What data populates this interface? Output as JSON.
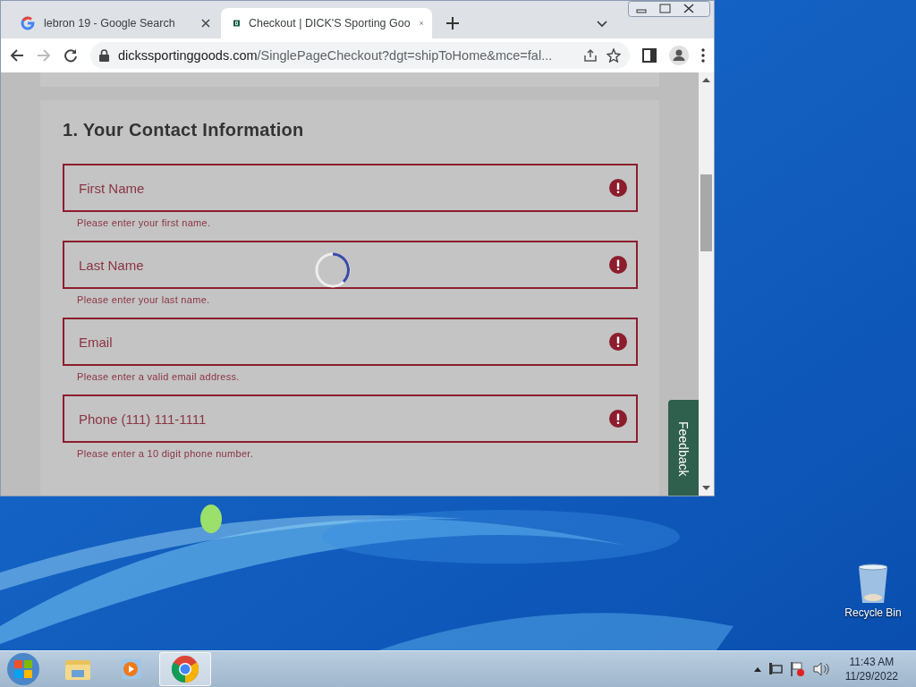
{
  "browser": {
    "tabs": [
      {
        "title": "lebron 19 - Google Search",
        "kind": "google",
        "selected": false
      },
      {
        "title": "Checkout | DICK'S Sporting Goo",
        "kind": "dicks",
        "selected": true
      }
    ],
    "address": {
      "domain": "dickssportinggoods.com",
      "path": "/SinglePageCheckout?dgt=shipToHome&mce=fal..."
    }
  },
  "page": {
    "loading": true,
    "section_title": "1. Your Contact Information",
    "fields": [
      {
        "placeholder": "First Name",
        "error": "Please enter your first name.",
        "invalid": true
      },
      {
        "placeholder": "Last Name",
        "error": "Please enter your last name.",
        "invalid": true
      },
      {
        "placeholder": "Email",
        "error": "Please enter a valid email address.",
        "invalid": true
      },
      {
        "placeholder": "Phone (111) 111-1111",
        "error": "Please enter a 10 digit phone number.",
        "invalid": true
      }
    ],
    "feedback_tab": "Feedback"
  },
  "desktop": {
    "icons": [
      {
        "label": "Recycle Bin"
      }
    ]
  },
  "taskbar": {
    "apps": [
      {
        "kind": "explorer",
        "selected": false
      },
      {
        "kind": "media",
        "selected": false
      },
      {
        "kind": "chrome",
        "selected": true
      }
    ],
    "clock": {
      "time": "11:43 AM",
      "date": "11/29/2022"
    }
  }
}
